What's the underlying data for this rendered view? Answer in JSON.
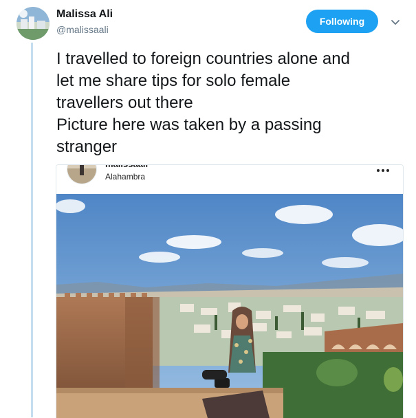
{
  "author": {
    "name": "Malissa Ali",
    "handle": "@malissaali"
  },
  "follow_button": {
    "label": "Following"
  },
  "tweet": {
    "text": "I travelled to foreign countries alone and\nlet me share tips for solo female\ntravellers out there\nPicture here was taken by a passing\nstranger"
  },
  "embed": {
    "username": "malissaali",
    "location": "Alahambra"
  },
  "icons": {
    "caret": "chevron-down-icon",
    "more": "more-dots-icon"
  },
  "colors": {
    "accent": "#1da1f2",
    "thread_line": "#c4def0",
    "handle_gray": "#657786"
  }
}
